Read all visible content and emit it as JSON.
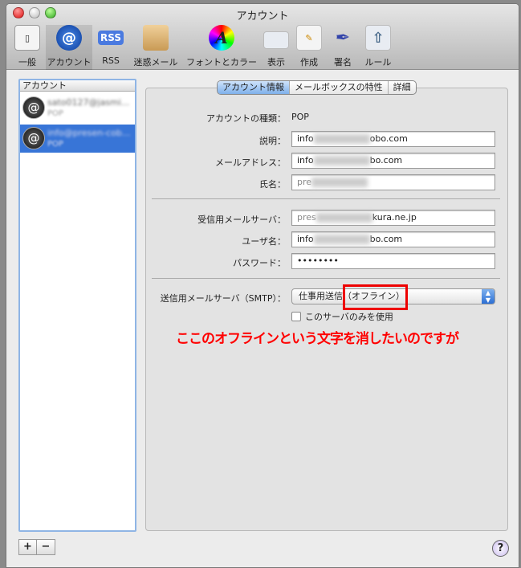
{
  "window": {
    "title": "アカウント"
  },
  "toolbar": {
    "items": [
      {
        "label": "一般",
        "icon": "switch-icon"
      },
      {
        "label": "アカウント",
        "icon": "at-icon"
      },
      {
        "label": "RSS",
        "icon": "rss-icon"
      },
      {
        "label": "迷惑メール",
        "icon": "junk-icon"
      },
      {
        "label": "フォントとカラー",
        "icon": "font-color-icon"
      },
      {
        "label": "表示",
        "icon": "view-icon"
      },
      {
        "label": "作成",
        "icon": "compose-icon"
      },
      {
        "label": "署名",
        "icon": "signature-icon"
      },
      {
        "label": "ルール",
        "icon": "rules-icon"
      }
    ],
    "rss_glyph": "RSS",
    "font_glyph": "A"
  },
  "accounts": {
    "header": "アカウント",
    "items": [
      {
        "name": "sato0127@jasmi...",
        "type": "POP"
      },
      {
        "name": "info@presen-cob...",
        "type": "POP"
      }
    ]
  },
  "tabs": [
    "アカウント情報",
    "メールボックスの特性",
    "詳細"
  ],
  "form": {
    "type_label": "アカウントの種類：",
    "type_value": "POP",
    "desc_label": "説明：",
    "desc_pre": "info",
    "desc_post": "obo.com",
    "email_label": "メールアドレス：",
    "email_pre": "info",
    "email_post": "bo.com",
    "name_label": "氏名：",
    "name_pre": "pre",
    "incoming_label": "受信用メールサーバ：",
    "incoming_pre": "pres",
    "incoming_post": "kura.ne.jp",
    "user_label": "ユーザ名：",
    "user_pre": "info",
    "user_post": "bo.com",
    "password_label": "パスワード：",
    "password_value": "••••••••",
    "smtp_label": "送信用メールサーバ（SMTP）：",
    "smtp_value": "仕事用送信（オフライン）",
    "only_server_label": "このサーバのみを使用"
  },
  "annotation": "ここのオフラインという文字を消したいのですが",
  "buttons": {
    "add": "+",
    "remove": "−",
    "help": "?"
  }
}
